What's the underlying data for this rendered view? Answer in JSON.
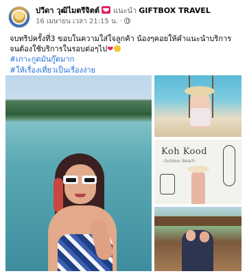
{
  "post": {
    "author_name": "ปวีดา วุฒิไมตรีจิตต์",
    "feeling_verb": "แนะนำ",
    "page_name": "GIFTBOX TRAVEL",
    "timestamp": "16 เมษายน เวลา 21:15 น.",
    "separator": "·",
    "caption_line": "จบทริปครั้งที่3 ขอบในความใส่ใจลูกค้า น้องๆคอยให้คำแนะนำบริการ จนต้องใช้บริการในรอบต่อๆไป",
    "hashtags": [
      "#เกาะกูดมันกู๊ดมาก",
      "#ให้เรื่องเที่ยวเป็นเรื่องง่าย"
    ],
    "mural_text": "Koh Kood",
    "mural_subtext": "Outdoor Beach"
  },
  "icons": [
    "avatar",
    "feeling-icon",
    "globe-icon",
    "heart-icon",
    "smile-icon"
  ],
  "colors": {
    "hashtag": "#216fdb",
    "meta": "#65676b",
    "heart": "#e0245e"
  }
}
